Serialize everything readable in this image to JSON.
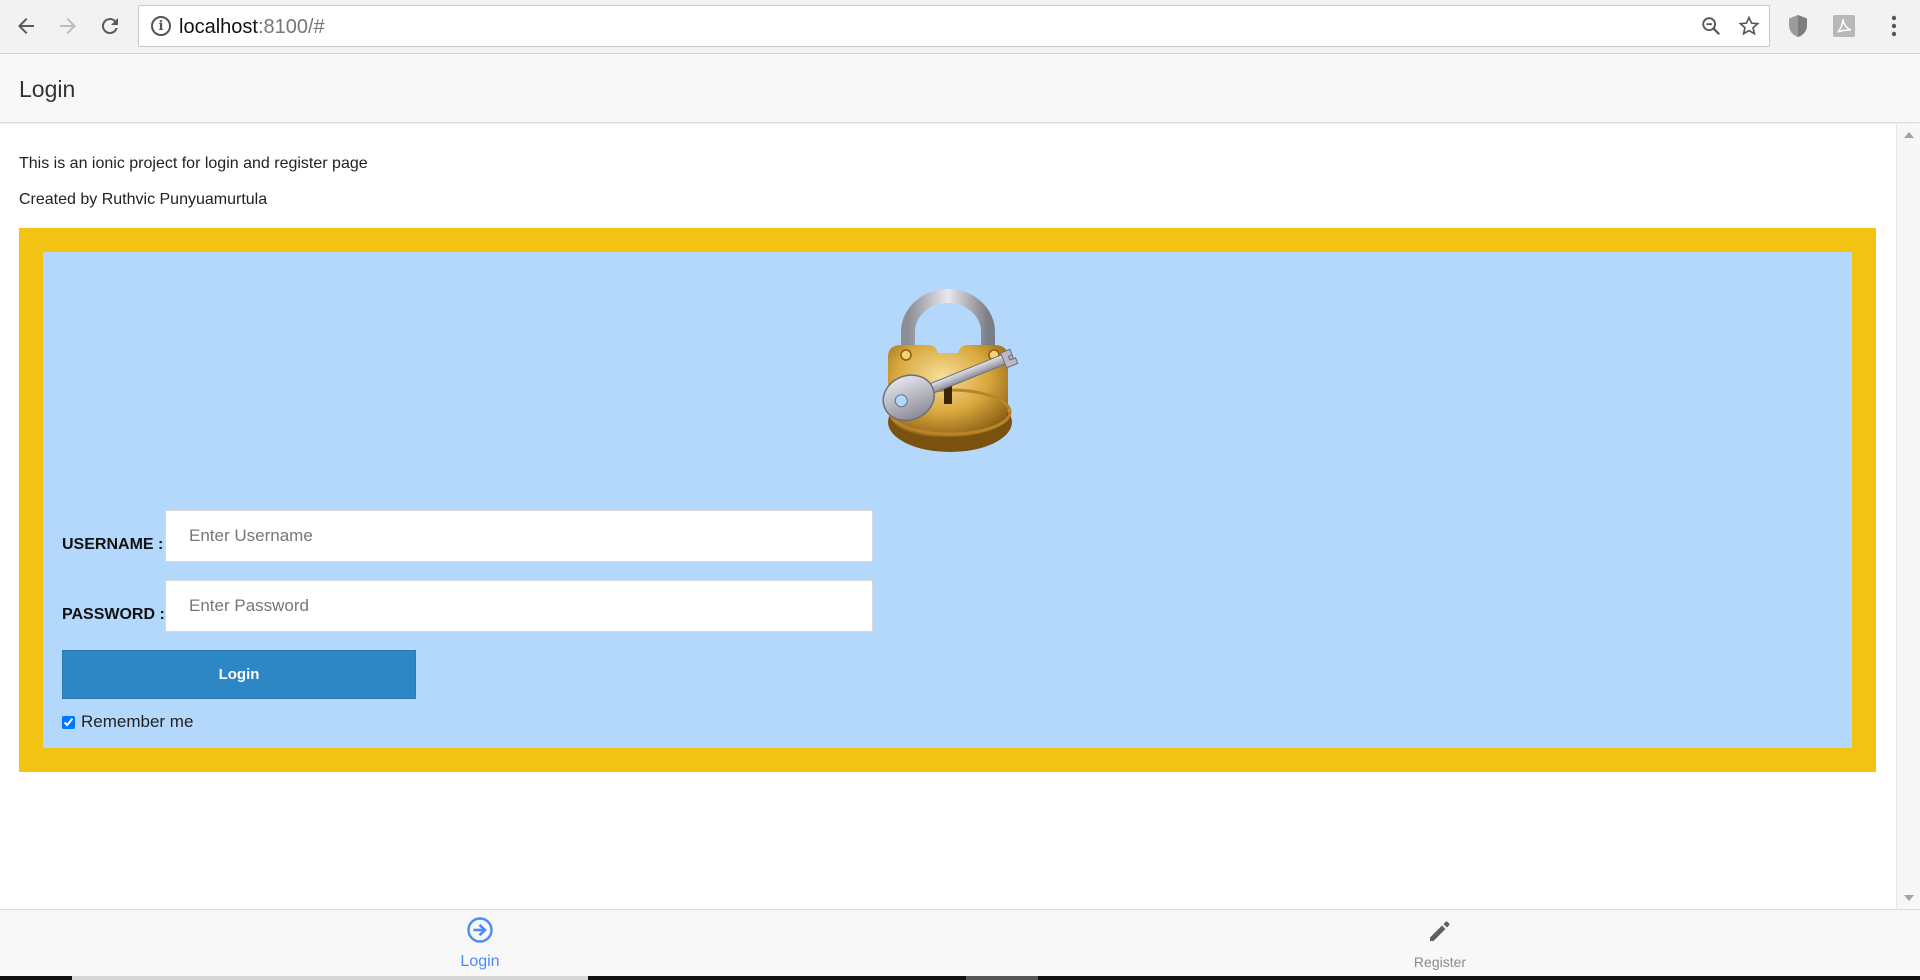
{
  "browser": {
    "back_icon": "back-arrow-icon",
    "forward_icon": "forward-arrow-icon",
    "reload_icon": "reload-icon",
    "url_host": "localhost",
    "url_rest": ":8100/#",
    "zoom_icon": "zoom-out-icon",
    "star_icon": "bookmark-star-icon",
    "menu_icon": "kebab-menu-icon"
  },
  "header": {
    "title": "Login"
  },
  "intro": {
    "line1": "This is an ionic project for login and register page",
    "line2": "Created by Ruthvic Punyuamurtula"
  },
  "form": {
    "username_label": "USERNAME :",
    "username_placeholder": "Enter Username",
    "username_value": "",
    "password_label": "PASSWORD :",
    "password_placeholder": "Enter Password",
    "password_value": "",
    "login_button": "Login",
    "remember_label": "Remember me",
    "remember_checked": true
  },
  "tabs": [
    {
      "label": "Login",
      "icon": "sign-in-icon",
      "active": true
    },
    {
      "label": "Register",
      "icon": "pencil-icon",
      "active": false
    }
  ],
  "colors": {
    "frame": "#f2c312",
    "panel": "#b4d8fc",
    "button": "#2e87c5",
    "active_tab": "#4a8bfc"
  }
}
